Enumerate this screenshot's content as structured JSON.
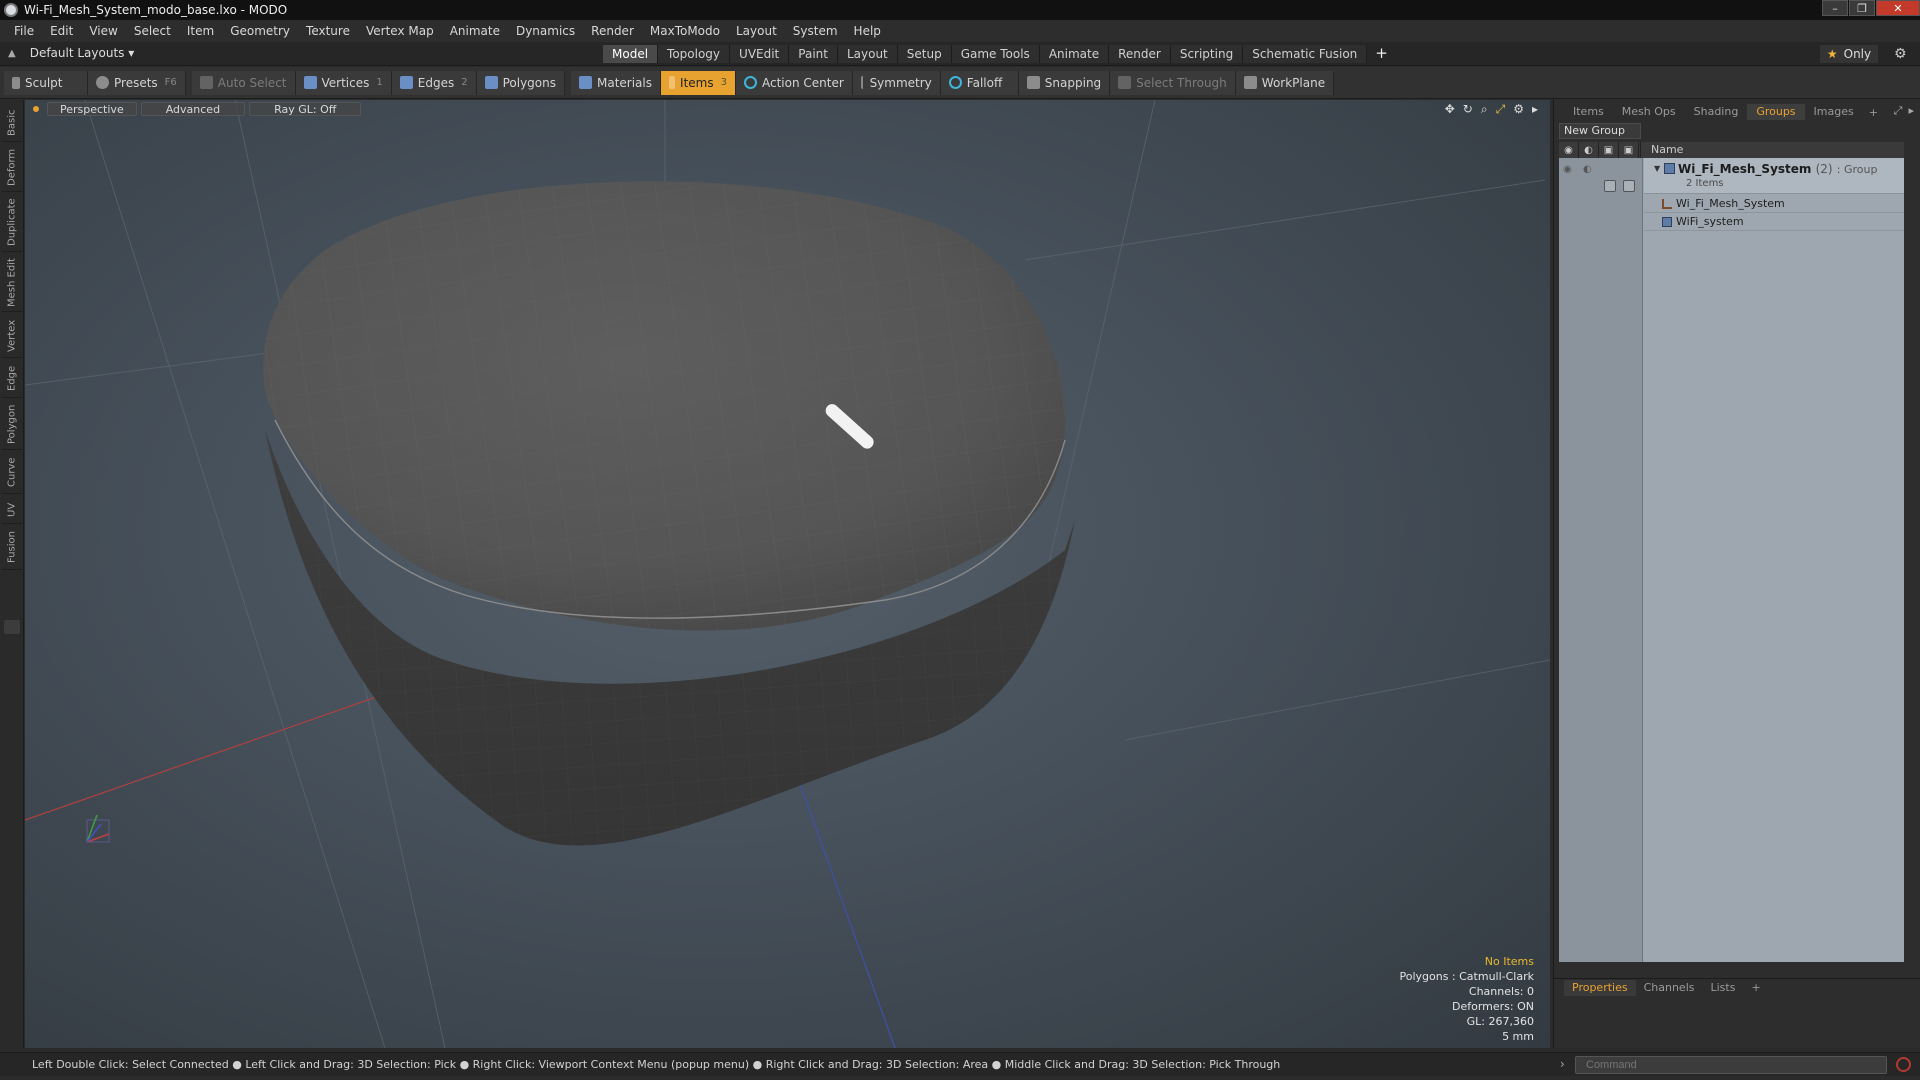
{
  "window": {
    "title": "Wi-Fi_Mesh_System_modo_base.lxo - MODO"
  },
  "menu": [
    "File",
    "Edit",
    "View",
    "Select",
    "Item",
    "Geometry",
    "Texture",
    "Vertex Map",
    "Animate",
    "Dynamics",
    "Render",
    "MaxToModo",
    "Layout",
    "System",
    "Help"
  ],
  "layout": {
    "selector": "Default Layouts ▾",
    "tabs": [
      "Model",
      "Topology",
      "UVEdit",
      "Paint",
      "Layout",
      "Setup",
      "Game Tools",
      "Animate",
      "Render",
      "Scripting",
      "Schematic Fusion"
    ],
    "active_tab": "Model",
    "only_label": "Only"
  },
  "toolbar": {
    "sculpt": "Sculpt",
    "presets": "Presets",
    "presets_key": "F6",
    "auto_select": "Auto Select",
    "vertices": "Vertices",
    "vertices_count": "1",
    "edges": "Edges",
    "edges_count": "2",
    "polygons": "Polygons",
    "materials": "Materials",
    "items": "Items",
    "items_count": "3",
    "action_center": "Action Center",
    "symmetry": "Symmetry",
    "falloff": "Falloff",
    "snapping": "Snapping",
    "select_through": "Select Through",
    "workplane": "WorkPlane"
  },
  "left_tabs": [
    "Basic",
    "Deform",
    "Duplicate",
    "Mesh Edit",
    "Vertex",
    "Edge",
    "Polygon",
    "Curve",
    "UV",
    "Fusion"
  ],
  "viewport": {
    "view": "Perspective",
    "shading": "Advanced",
    "raygl": "Ray GL: Off",
    "info": {
      "selection": "No Items",
      "polygons": "Polygons : Catmull-Clark",
      "channels": "Channels: 0",
      "deformers": "Deformers: ON",
      "gl": "GL: 267,360",
      "scale": "5 mm"
    }
  },
  "right_panel": {
    "tabs": [
      "Items",
      "Mesh Ops",
      "Shading",
      "Groups",
      "Images"
    ],
    "active_tab": "Groups",
    "new_group": "New Group",
    "column_name": "Name",
    "group": {
      "name": "Wi_Fi_Mesh_System",
      "count": "(2)",
      "type": ": Group",
      "sub": "2 Items"
    },
    "rows": [
      "Wi_Fi_Mesh_System",
      "WiFi_system"
    ],
    "props_tabs": [
      "Properties",
      "Channels",
      "Lists"
    ],
    "props_active": "Properties"
  },
  "status": {
    "hint": "Left Double Click: Select Connected ● Left Click and Drag: 3D Selection: Pick ● Right Click: Viewport Context Menu (popup menu) ● Right Click and Drag: 3D Selection: Area ● Middle Click and Drag: 3D Selection: Pick Through",
    "command_placeholder": "Command"
  },
  "colors": {
    "accent": "#e8a230",
    "viewport_bg": "#46505a",
    "model_body": "#505050"
  }
}
